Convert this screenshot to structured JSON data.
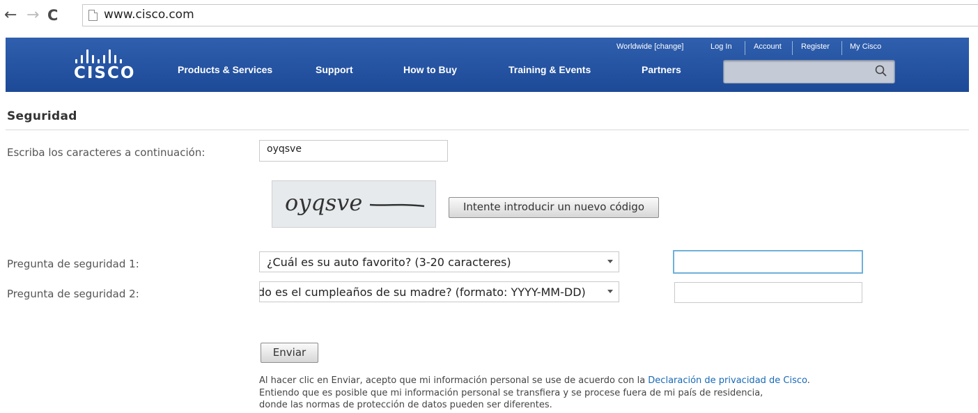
{
  "browser": {
    "back_icon": "arrow-left-icon",
    "forward_icon": "arrow-right-icon",
    "reload_icon": "reload-icon",
    "url": "www.cisco.com"
  },
  "header": {
    "logo_text": "CISCO",
    "utility_links": [
      "Worldwide [change]",
      "Log In",
      "Account",
      "Register",
      "My Cisco"
    ],
    "nav": [
      "Products & Services",
      "Support",
      "How to Buy",
      "Training & Events",
      "Partners"
    ],
    "search_placeholder": "",
    "brand_color": "#2a5aa8"
  },
  "page": {
    "title": "Seguridad",
    "captcha_label": "Escriba los caracteres a continuación:",
    "captcha_value": "oyqsve",
    "captcha_image_text": "oyqsve",
    "new_code_button": "Intente introducir un nuevo código",
    "q1_label": "Pregunta de seguridad 1:",
    "q1_selected": "¿Cuál es su auto favorito? (3-20 caracteres)",
    "q1_answer": "",
    "q2_label": "Pregunta de seguridad 2:",
    "q2_selected": "do es el cumpleaños de su madre? (formato: YYYY-MM-DD)",
    "q2_answer": "",
    "submit_button": "Enviar",
    "legal_line1_pre": "Al hacer clic en Enviar, acepto que mi información personal se use de acuerdo con la ",
    "legal_link": "Declaración de privacidad de Cisco",
    "legal_line1_post": ".",
    "legal_line2": "Entiendo que es posible que mi información personal se transfiera y se procese fuera de mi país de residencia,",
    "legal_line3": "donde las normas de protección de datos pueden ser diferentes."
  }
}
